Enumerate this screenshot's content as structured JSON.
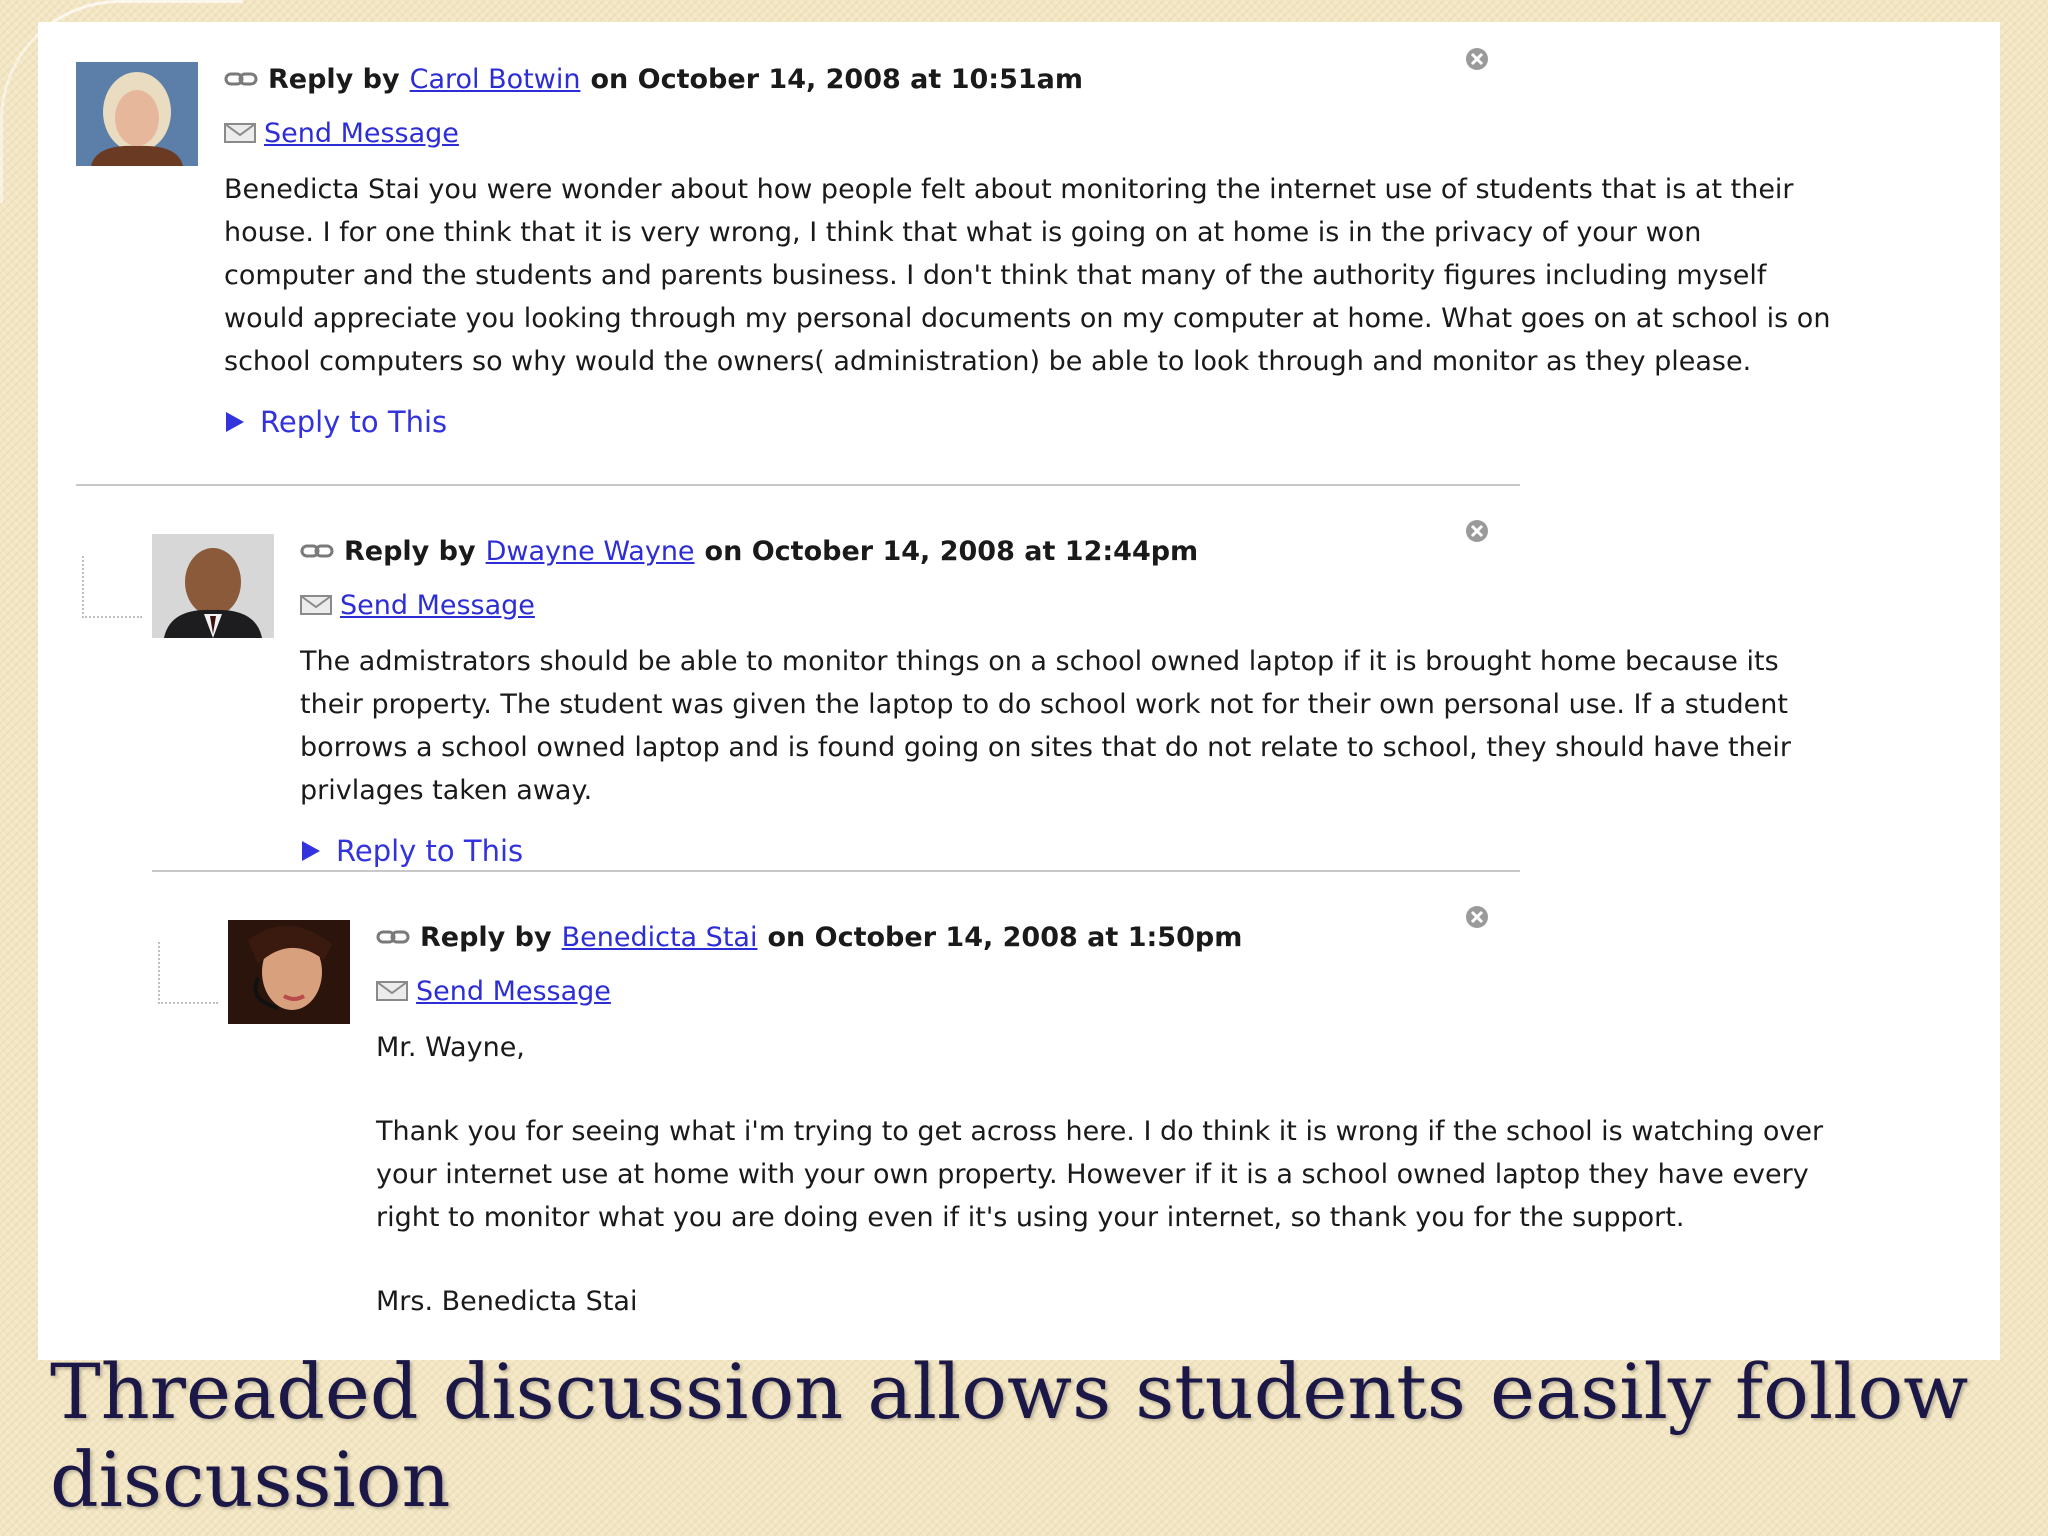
{
  "slide": {
    "title": "Threaded discussion allows students easily follow discussion"
  },
  "thread": {
    "posts": [
      {
        "author": "Carol Botwin",
        "prefix": "Reply by",
        "date": "on October 14, 2008 at 10:51am",
        "send_message": "Send Message",
        "paragraphs": [
          "Benedicta Stai you were wonder about how people felt about monitoring the internet use of students that is at their house. I for one think that it is very wrong, I think that what is going on at home is in the privacy of your won computer and the students and parents business. I don't think that many of the authority figures including myself would appreciate you looking through my personal documents on my computer at home. What goes on at school is on school computers so why would the owners( administration) be able to look through and monitor as they please."
        ],
        "reply_label": "Reply to This"
      },
      {
        "author": "Dwayne Wayne",
        "prefix": "Reply by",
        "date": "on October 14, 2008 at 12:44pm",
        "send_message": "Send Message",
        "paragraphs": [
          "The admistrators should be able to monitor things on a school owned laptop if it is brought home because its their property. The student was given the laptop to do school work not for their own personal use. If a student borrows a school owned laptop and is found going on sites that do not relate to school, they should have their privlages taken away."
        ],
        "reply_label": "Reply to This"
      },
      {
        "author": "Benedicta Stai",
        "prefix": "Reply by",
        "date": "on October 14, 2008 at 1:50pm",
        "send_message": "Send Message",
        "paragraphs": [
          "Mr. Wayne,",
          "Thank you for seeing what i'm trying to get across here. I do think it is wrong if the school is watching over your internet use at home with your own property. However if it is a school owned laptop they have every right to monitor what you are doing even if it's using your internet, so thank you for the support.",
          "Mrs. Benedicta Stai"
        ]
      }
    ]
  },
  "icons": {
    "permalink": "link-icon",
    "message": "mail-icon",
    "reply": "triangle-right-icon",
    "delete": "close-icon"
  },
  "colors": {
    "link": "#2d2dd6",
    "reply_link": "#3333dd",
    "title": "#1b1848",
    "background": "#f3e6c3"
  }
}
